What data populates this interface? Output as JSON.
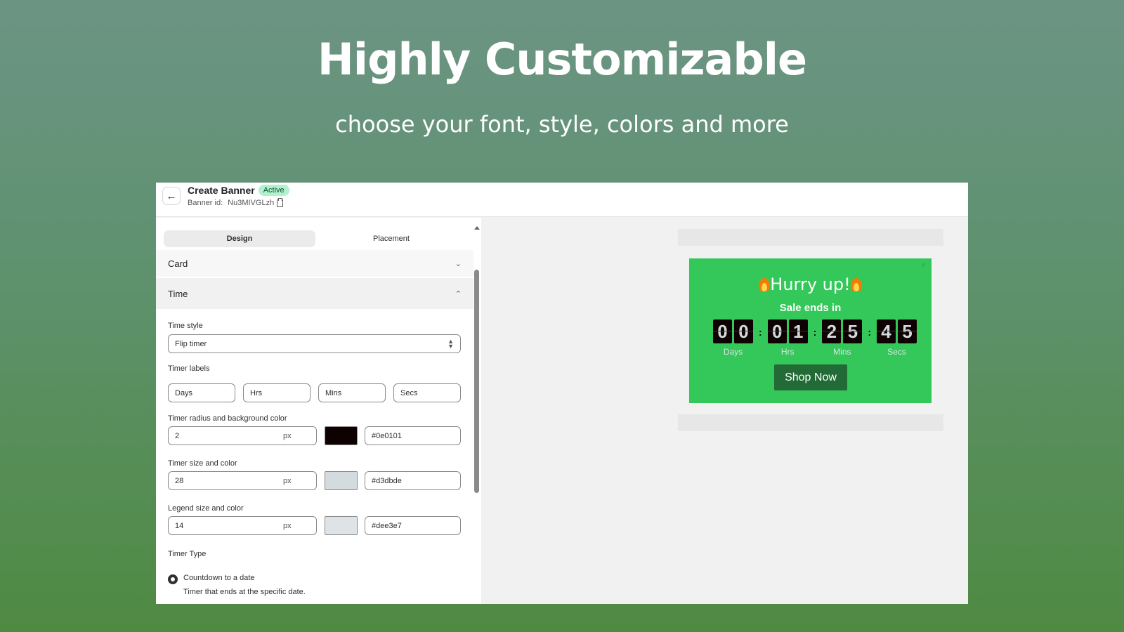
{
  "hero": {
    "title": "Highly Customizable",
    "subtitle": "choose your font, style, colors and more"
  },
  "header": {
    "title": "Create Banner",
    "status": "Active",
    "id_label": "Banner id:",
    "id_value": "Nu3MIVGLzh"
  },
  "tabs": [
    {
      "label": "Design",
      "active": true
    },
    {
      "label": "Placement",
      "active": false
    }
  ],
  "sections": {
    "card": "Card",
    "time": "Time"
  },
  "form": {
    "time_style_label": "Time style",
    "time_style_value": "Flip timer",
    "timer_labels_label": "Timer labels",
    "timer_labels": [
      "Days",
      "Hrs",
      "Mins",
      "Secs"
    ],
    "radius_bg_label": "Timer radius and background color",
    "radius_value": "2",
    "radius_unit": "px",
    "bg_color": "#0e0101",
    "size_color_label": "Timer size and color",
    "size_value": "28",
    "size_unit": "px",
    "digit_color": "#d3dbde",
    "legend_label": "Legend size and color",
    "legend_size": "14",
    "legend_unit": "px",
    "legend_color": "#dee3e7",
    "timer_type_label": "Timer Type",
    "radio_label": "Countdown to a date",
    "radio_help": "Timer that ends at the specific date."
  },
  "banner": {
    "bg_color": "#34c759",
    "title": "Hurry up!",
    "subtitle": "Sale ends in",
    "close": "×",
    "digits": {
      "days": [
        "0",
        "0"
      ],
      "hrs": [
        "0",
        "1"
      ],
      "mins": [
        "2",
        "5"
      ],
      "secs": [
        "4",
        "5"
      ]
    },
    "legends": [
      "Days",
      "Hrs",
      "Mins",
      "Secs"
    ],
    "separator": ":",
    "button": "Shop Now"
  }
}
